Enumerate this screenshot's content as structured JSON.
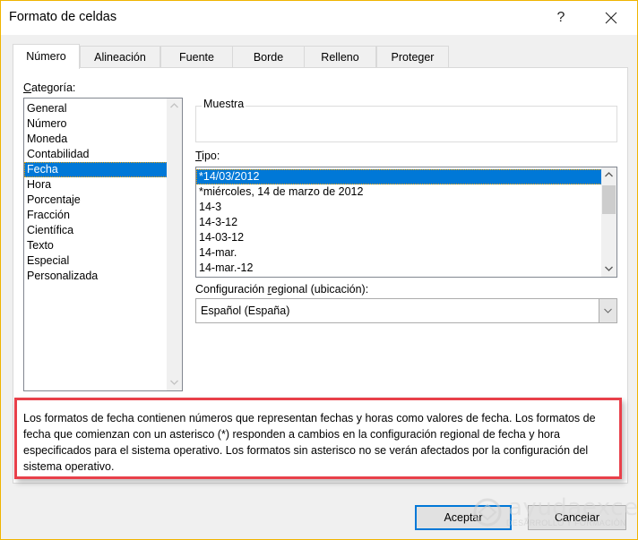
{
  "window": {
    "title": "Formato de celdas",
    "help_label": "?",
    "close_icon": "close-icon"
  },
  "tabs": [
    {
      "label": "Número",
      "active": true
    },
    {
      "label": "Alineación",
      "active": false
    },
    {
      "label": "Fuente",
      "active": false
    },
    {
      "label": "Borde",
      "active": false
    },
    {
      "label": "Relleno",
      "active": false
    },
    {
      "label": "Proteger",
      "active": false
    }
  ],
  "category": {
    "label_underlined": "C",
    "label_rest": "ategoría:",
    "items": [
      "General",
      "Número",
      "Moneda",
      "Contabilidad",
      "Fecha",
      "Hora",
      "Porcentaje",
      "Fracción",
      "Científica",
      "Texto",
      "Especial",
      "Personalizada"
    ],
    "selected": "Fecha"
  },
  "sample": {
    "label": "Muestra",
    "value": ""
  },
  "type": {
    "label_underlined": "T",
    "label_rest": "ipo:",
    "items": [
      "*14/03/2012",
      "*miércoles, 14 de marzo de 2012",
      "14-3",
      "14-3-12",
      "14-03-12",
      "14-mar.",
      "14-mar.-12"
    ],
    "selected": "*14/03/2012"
  },
  "locale": {
    "label_before": "Configuración ",
    "label_underlined": "r",
    "label_after": "egional (ubicación):",
    "value": "Español (España)"
  },
  "description": "Los formatos de fecha contienen números que representan fechas y horas como valores de fecha. Los formatos de fecha que comienzan con un asterisco (*) responden a cambios en la configuración regional de fecha y hora especificados para el sistema operativo. Los formatos sin asterisco no se verán afectados por la configuración del sistema operativo.",
  "buttons": {
    "ok": "Aceptar",
    "cancel": "Cancelar"
  },
  "watermark": {
    "brand": "ayudaexcel",
    "tagline": "DESARROLLO Y FORMACIÓN"
  },
  "colors": {
    "window_border": "#f0b400",
    "selection": "#0078d7",
    "highlight_box": "#e8404a"
  }
}
